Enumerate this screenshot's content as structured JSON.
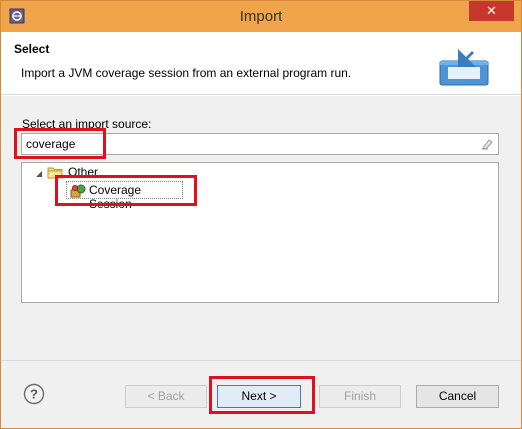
{
  "window": {
    "title": "Import",
    "close_glyph": "✕"
  },
  "header": {
    "title": "Select",
    "description": "Import a JVM coverage session from an external program run."
  },
  "source": {
    "label": "Select an import source:",
    "filter_value": "coverage"
  },
  "tree": {
    "category": "Other",
    "item": "Coverage Session"
  },
  "buttons": {
    "back": "< Back",
    "next": "Next >",
    "finish": "Finish",
    "cancel": "Cancel"
  },
  "colors": {
    "titlebar": "#f0a54d",
    "close": "#c7382c",
    "highlight": "#e0101e"
  }
}
